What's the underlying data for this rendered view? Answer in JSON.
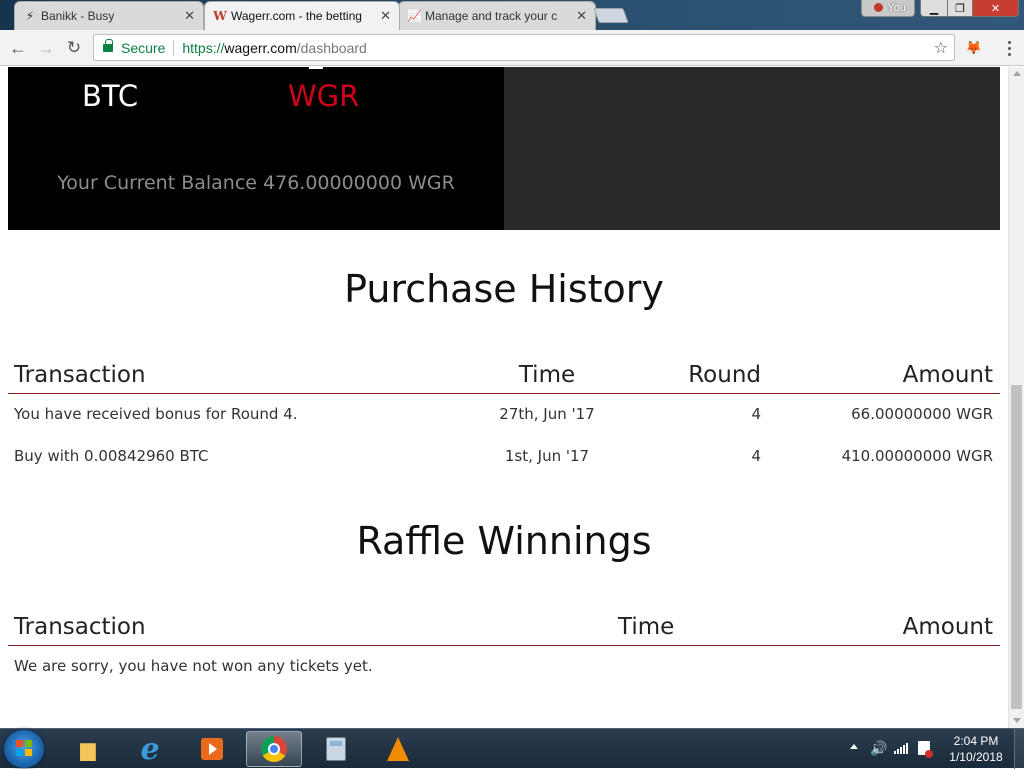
{
  "browser": {
    "tabs": [
      {
        "title": "Banikk - Busy",
        "icon": "bolt-icon",
        "active": false
      },
      {
        "title": "Wagerr.com - the betting",
        "icon": "wagerr-w-icon",
        "active": true
      },
      {
        "title": "Manage and track your c",
        "icon": "chart-icon",
        "active": false
      }
    ],
    "tab_close_glyph": "✕",
    "profile_label": "You",
    "url": {
      "secure_label": "Secure",
      "scheme": "https://",
      "host": "wagerr.com",
      "path": "/dashboard"
    }
  },
  "hero": {
    "currency_btc": "BTC",
    "currency_wgr": "WGR",
    "balance_text": "Your Current Balance 476.00000000 WGR"
  },
  "purchase_history": {
    "title": "Purchase History",
    "columns": {
      "transaction": "Transaction",
      "time": "Time",
      "round": "Round",
      "amount": "Amount"
    },
    "rows": [
      {
        "transaction": "You have received bonus for Round 4.",
        "time": "27th, Jun '17",
        "round": "4",
        "amount": "66.00000000 WGR"
      },
      {
        "transaction": "Buy with 0.00842960 BTC",
        "time": "1st, Jun '17",
        "round": "4",
        "amount": "410.00000000 WGR"
      }
    ]
  },
  "raffle_winnings": {
    "title": "Raffle Winnings",
    "columns": {
      "transaction": "Transaction",
      "time": "Time",
      "amount": "Amount"
    },
    "empty_message": "We are sorry, you have not won any tickets yet."
  },
  "taskbar": {
    "clock_time": "2:04 PM",
    "clock_date": "1/10/2018"
  },
  "colors": {
    "brand_red": "#d0021b",
    "table_rule": "#8b1a1a",
    "secure_green": "#0b8043"
  }
}
